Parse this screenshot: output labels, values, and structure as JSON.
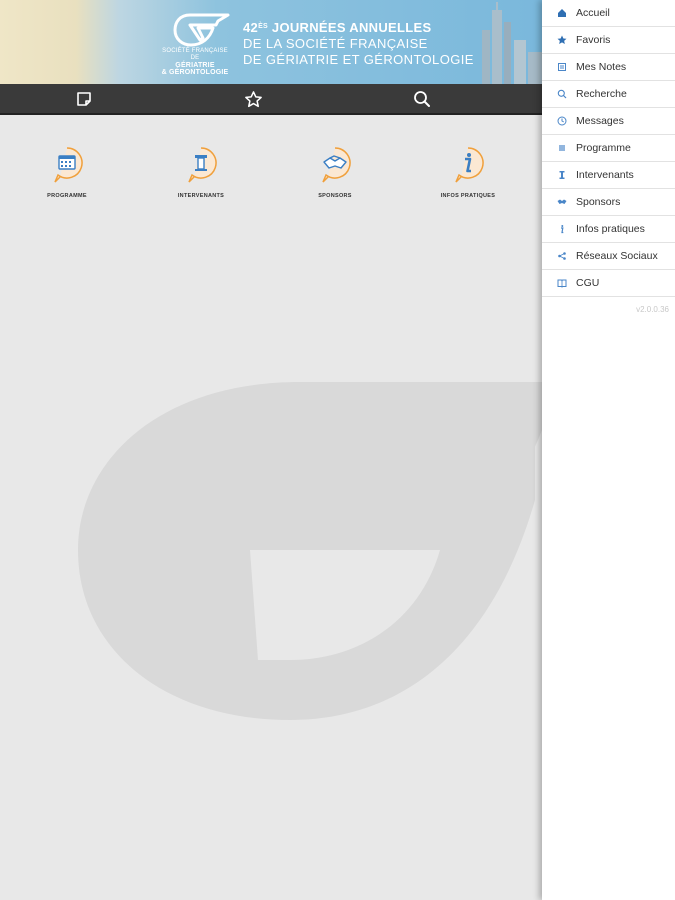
{
  "banner": {
    "logo_line1": "SOCIÉTÉ FRANÇAISE",
    "logo_line2": "DE",
    "logo_line3": "GÉRIATRIE",
    "logo_line4": "& GÉRONTOLOGIE",
    "title_number": "42",
    "title_suffix": "ÈS",
    "title_line1": " JOURNÉES ANNUELLES",
    "title_line2": "DE LA SOCIÉTÉ FRANÇAISE",
    "title_line3": "DE GÉRIATRIE ET GÉRONTOLOGIE"
  },
  "toolbar": {
    "icons": [
      "notes-icon",
      "star-icon",
      "search-icon"
    ]
  },
  "tiles": [
    {
      "label": "PROGRAMME",
      "icon": "calendar-icon"
    },
    {
      "label": "INTERVENANTS",
      "icon": "podium-icon"
    },
    {
      "label": "SPONSORS",
      "icon": "handshake-icon"
    },
    {
      "label": "INFOS PRATIQUES",
      "icon": "info-icon"
    }
  ],
  "drawer": {
    "items": [
      {
        "label": "Accueil",
        "icon": "home-icon"
      },
      {
        "label": "Favoris",
        "icon": "star-icon"
      },
      {
        "label": "Mes Notes",
        "icon": "notes-icon"
      },
      {
        "label": "Recherche",
        "icon": "search-icon"
      },
      {
        "label": "Messages",
        "icon": "clock-icon"
      },
      {
        "label": "Programme",
        "icon": "list-icon"
      },
      {
        "label": "Intervenants",
        "icon": "podium-icon"
      },
      {
        "label": "Sponsors",
        "icon": "handshake-icon"
      },
      {
        "label": "Infos pratiques",
        "icon": "info-icon"
      },
      {
        "label": "Réseaux Sociaux",
        "icon": "share-icon"
      },
      {
        "label": "CGU",
        "icon": "book-icon"
      }
    ],
    "version": "v2.0.0.36"
  },
  "colors": {
    "accent": "#3b7fc4",
    "tile_ring": "#f0a03c",
    "toolbar": "#3a3a3a",
    "drawer_icon": "#4a86c8"
  }
}
